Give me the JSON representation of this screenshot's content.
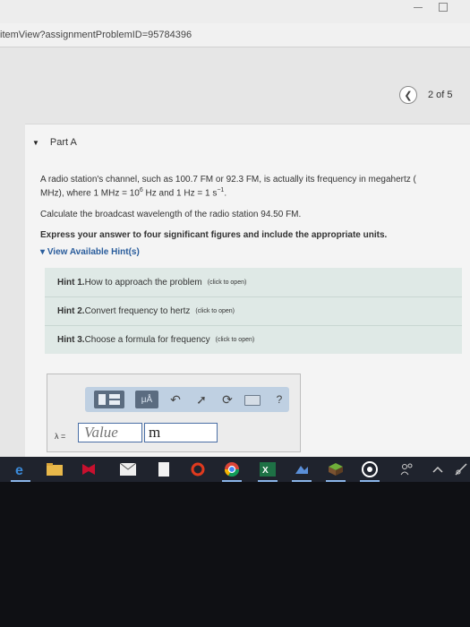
{
  "browser": {
    "url": "itemView?assignmentProblemID=95784396"
  },
  "pager": {
    "prev_icon": "chevron-left-icon",
    "text": "2 of 5"
  },
  "part": {
    "label": "Part A"
  },
  "question": {
    "line1": "A radio station's channel, such as 100.7 FM or 92.3 FM, is actually its frequency in megahertz (",
    "line2": "MHz), where 1 MHz = 10",
    "exp1": "6",
    "line2b": " Hz and 1 Hz = 1 s",
    "exp2": "−1",
    "line2c": ".",
    "calc": "Calculate the broadcast wavelength of the radio station 94.50 FM.",
    "instruction": "Express your answer to four significant figures and include the appropriate units."
  },
  "hints": {
    "toggle_label": "View Available Hint(s)",
    "items": [
      {
        "num": "Hint 1.",
        "text": " How to approach the problem",
        "open": "(click to open)"
      },
      {
        "num": "Hint 2.",
        "text": " Convert frequency to hertz",
        "open": "(click to open)"
      },
      {
        "num": "Hint 3.",
        "text": " Choose a formula for frequency",
        "open": "(click to open)"
      }
    ]
  },
  "answer": {
    "units_button": "μÅ",
    "help": "?",
    "variable_label": "λ =",
    "value_placeholder": "Value",
    "unit_value": "m"
  },
  "colors": {
    "accent_link": "#2a5d9c",
    "hint_bg": "#dfe9e6",
    "toolbar_bg": "#bfd0e2",
    "taskbar_bg": "#1f232d"
  }
}
